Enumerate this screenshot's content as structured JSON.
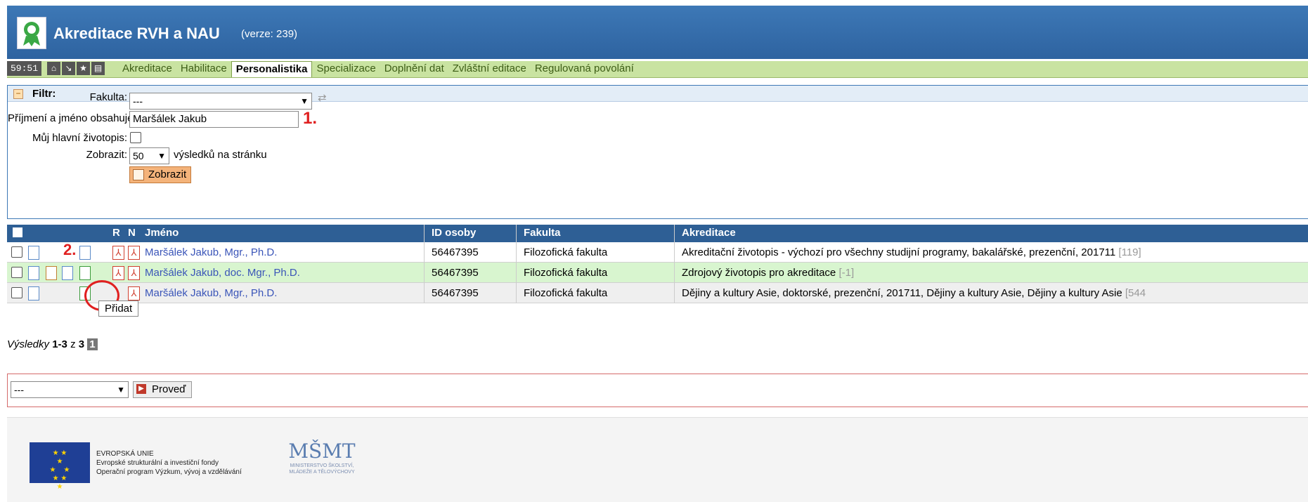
{
  "header": {
    "title": "Akreditace RVH a NAU",
    "version": "(verze: 239)"
  },
  "nav": {
    "timer": "59:51",
    "icons": [
      "home-icon",
      "arrow-icon",
      "star-icon",
      "print-icon"
    ],
    "tabs": [
      {
        "label": "Akreditace"
      },
      {
        "label": "Habilitace"
      },
      {
        "label": "Personalistika",
        "active": true
      },
      {
        "label": "Specializace"
      },
      {
        "label": "Doplnění dat"
      },
      {
        "label": "Zvláštní editace"
      },
      {
        "label": "Regulovaná povolání"
      }
    ]
  },
  "filter": {
    "title": "Filtr:",
    "fakulta_label": "Fakulta:",
    "fakulta_value": "---",
    "name_label": "Příjmení a jméno obsahuje:",
    "name_value": "Maršálek Jakub",
    "cv_label": "Můj hlavní životopis:",
    "show_label": "Zobrazit:",
    "show_value": "50",
    "show_suffix": "výsledků na stránku",
    "submit_label": "Zobrazit"
  },
  "annotations": {
    "step1": "1.",
    "step2": "2."
  },
  "table": {
    "columns": [
      "R",
      "N",
      "Jméno",
      "ID osoby",
      "Fakulta",
      "Akreditace"
    ],
    "rows": [
      {
        "name": "Maršálek Jakub, Mgr., Ph.D.",
        "id": "56467395",
        "faculty": "Filozofická fakulta",
        "accreditation": "Akreditační životopis - výchozí pro všechny studijní programy, bakalářské, prezenční, 201711",
        "count": "[119]"
      },
      {
        "name": "Maršálek Jakub, doc. Mgr., Ph.D.",
        "id": "56467395",
        "faculty": "Filozofická fakulta",
        "accreditation": "Zdrojový životopis pro akreditace",
        "count": "[-1]"
      },
      {
        "name": "Maršálek Jakub, Mgr., Ph.D.",
        "id": "56467395",
        "faculty": "Filozofická fakulta",
        "accreditation": "Dějiny a kultury Asie, doktorské, prezenční, 201711, Dějiny a kultury Asie, Dějiny a kultury Asie",
        "count": "[544"
      }
    ]
  },
  "tooltip": "Přidat",
  "pagination": {
    "label": "Výsledky",
    "range": "1-3",
    "of": "z",
    "total": "3",
    "page": "1"
  },
  "actions": {
    "select_value": "---",
    "run_label": "Proveď"
  },
  "footer": {
    "eu_line1": "EVROPSKÁ UNIE",
    "eu_line2": "Evropské strukturální a investiční fondy",
    "eu_line3": "Operační program Výzkum, vývoj a vzdělávání",
    "msmt_line1": "MINISTERSTVO ŠKOLSTVÍ,",
    "msmt_line2": "MLÁDEŽE A TĚLOVÝCHOVY"
  }
}
